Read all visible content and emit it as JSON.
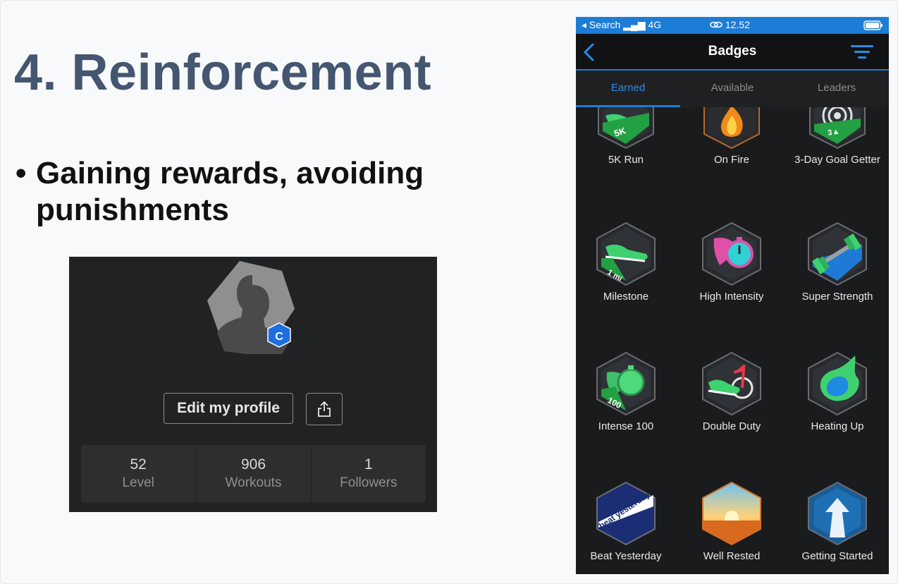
{
  "slide": {
    "title": "4. Reinforcement",
    "bullet_dot": "•",
    "bullet_text": "Gaining rewards, avoiding punishments"
  },
  "profile_card": {
    "badge_letter": "C",
    "edit_label": "Edit my profile",
    "share_icon": "share-icon",
    "stats": [
      {
        "value": "52",
        "label": "Level"
      },
      {
        "value": "906",
        "label": "Workouts"
      },
      {
        "value": "1",
        "label": "Followers"
      }
    ]
  },
  "phone": {
    "status_left": "◂ Search ▂▄▆ 4G",
    "status_time": "12.52",
    "title": "Badges",
    "tabs": [
      "Earned",
      "Available",
      "Leaders"
    ],
    "active_tab": "Earned",
    "accent": "#1c7cd6",
    "badges": [
      {
        "name": "5K Run",
        "tag": "5K",
        "icon": "shoe-icon"
      },
      {
        "name": "On Fire",
        "tag": "",
        "icon": "flame-icon"
      },
      {
        "name": "3-Day Goal Getter",
        "tag": "3▲",
        "icon": "target-icon"
      },
      {
        "name": "Milestone",
        "tag": "1 mi",
        "icon": "shoe-icon"
      },
      {
        "name": "High Intensity",
        "tag": "",
        "icon": "stopwatch-icon"
      },
      {
        "name": "Super Strength",
        "tag": "",
        "icon": "dumbbell-icon"
      },
      {
        "name": "Intense 100",
        "tag": "100",
        "icon": "stopwatch-icon"
      },
      {
        "name": "Double Duty",
        "tag": "",
        "icon": "bike-shoe-icon"
      },
      {
        "name": "Heating Up",
        "tag": "",
        "icon": "flame-icon"
      },
      {
        "name": "Beat Yesterday",
        "tag": "beat yesterday.",
        "icon": "text-badge-icon"
      },
      {
        "name": "Well Rested",
        "tag": "",
        "icon": "sunrise-icon"
      },
      {
        "name": "Getting Started",
        "tag": "",
        "icon": "arrow-up-icon"
      }
    ]
  }
}
